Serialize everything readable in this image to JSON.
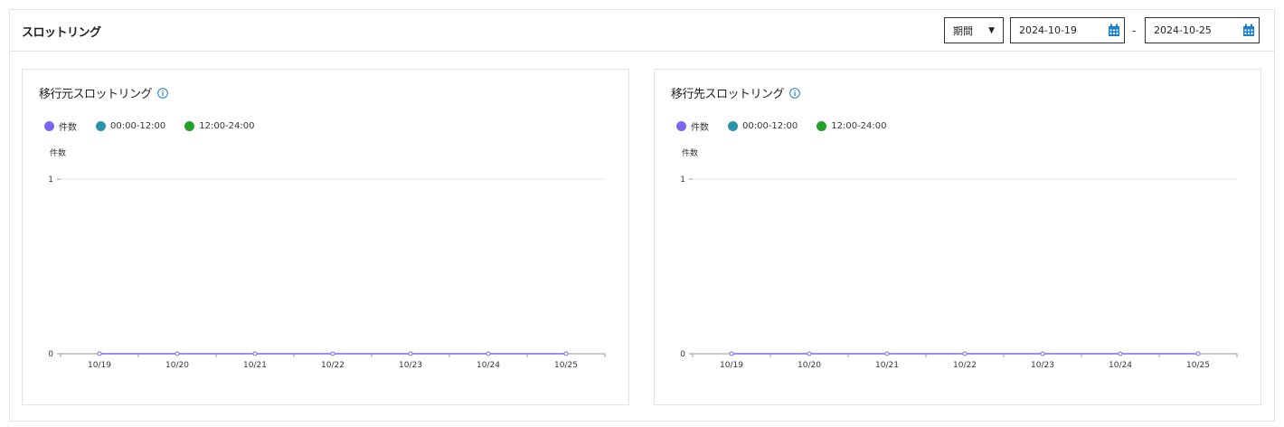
{
  "header": {
    "title": "スロットリング",
    "period_label": "期間",
    "date_from": "2024-10-19",
    "date_separator": "-",
    "date_to": "2024-10-25"
  },
  "colors": {
    "count": "#7b68ee",
    "am": "#2a95a8",
    "pm": "#22a02a",
    "calendar": "#1a7fd0"
  },
  "cards": [
    {
      "title": "移行元スロットリング",
      "legend": [
        "件数",
        "00:00-12:00",
        "12:00-24:00"
      ],
      "y_axis_title": "件数"
    },
    {
      "title": "移行先スロットリング",
      "legend": [
        "件数",
        "00:00-12:00",
        "12:00-24:00"
      ],
      "y_axis_title": "件数"
    }
  ],
  "chart_data": [
    {
      "type": "line",
      "title": "移行元スロットリング",
      "categories": [
        "10/19",
        "10/20",
        "10/21",
        "10/22",
        "10/23",
        "10/24",
        "10/25"
      ],
      "series": [
        {
          "name": "件数",
          "values": [
            0,
            0,
            0,
            0,
            0,
            0,
            0
          ]
        }
      ],
      "ylabel": "件数",
      "ylim": [
        0,
        1
      ],
      "yticks": [
        0,
        1
      ],
      "legend_position": "top-left",
      "grid": true
    },
    {
      "type": "line",
      "title": "移行先スロットリング",
      "categories": [
        "10/19",
        "10/20",
        "10/21",
        "10/22",
        "10/23",
        "10/24",
        "10/25"
      ],
      "series": [
        {
          "name": "件数",
          "values": [
            0,
            0,
            0,
            0,
            0,
            0,
            0
          ]
        }
      ],
      "ylabel": "件数",
      "ylim": [
        0,
        1
      ],
      "yticks": [
        0,
        1
      ],
      "legend_position": "top-left",
      "grid": true
    }
  ]
}
